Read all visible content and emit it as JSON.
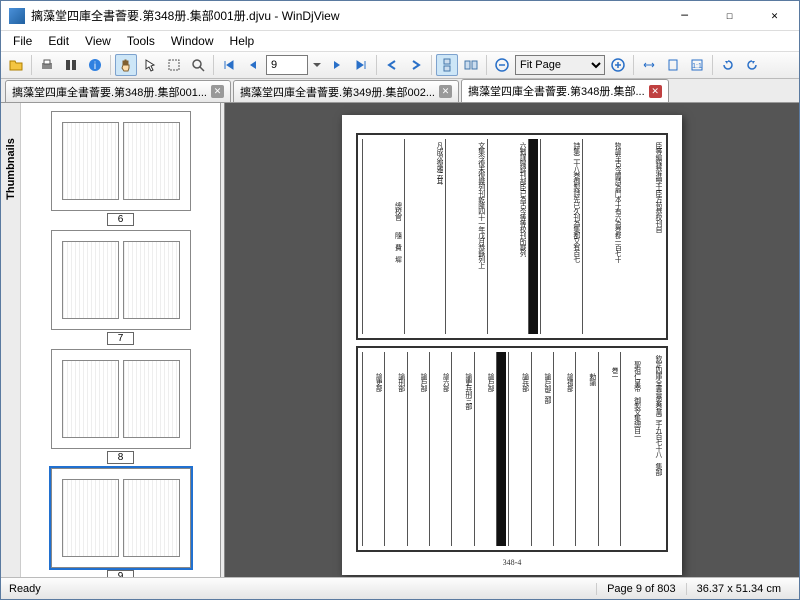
{
  "title": "摛藻堂四庫全書薈要.第348册.集部001册.djvu - WinDjView",
  "menu": [
    "File",
    "Edit",
    "View",
    "Tools",
    "Window",
    "Help"
  ],
  "toolbar": {
    "page_value": "9",
    "zoom_value": "Fit Page"
  },
  "tabs": [
    {
      "label": "摛藻堂四庫全書薈要.第348册.集部001...",
      "active": false
    },
    {
      "label": "摛藻堂四庫全書薈要.第349册.集部002...",
      "active": false
    },
    {
      "label": "摛藻堂四庫全書薈要.第348册.集部...",
      "active": true
    }
  ],
  "sidebar": {
    "label": "Thumbnails",
    "thumbs": [
      6,
      7,
      8,
      9
    ],
    "selected": 9
  },
  "doc": {
    "page_num": "348-4",
    "top_cols": [
      "臣等編錄恭進學士臣方苞恭校刊自",
      "物諭至古今體詩為門本十有六為巻都一百七十",
      "詩集二十八巻御製詩先已久刊為集都又有百七",
      "六數謹歸録刊部臣已為古今等等校刊所載列",
      "文集今復未復幾列刊乾隆四十一年戊月恭錄列上",
      "凡成次復雅云耳",
      "　　　　　　　　　　總校官　　隨　費　墀"
    ],
    "bot_cols": [
      "欽定四庫全書薈要巻萬二千九百七十八　集部",
      "　聖祖仁皇帝　御製文集總目一",
      "　　巻一",
      "　　　勅諭",
      "　　　諭禮部",
      "　　　諭戶部二部",
      "　　　諭兵部",
      "　　　諭戶部",
      "　　　諭吏兵刑三部",
      "　　　諭六部",
      "　　　諭戶部",
      "　　　諭刑部",
      "　　　諭吏部"
    ]
  },
  "status": {
    "ready": "Ready",
    "page": "Page 9 of 803",
    "size": "36.37 x 51.34 cm"
  }
}
